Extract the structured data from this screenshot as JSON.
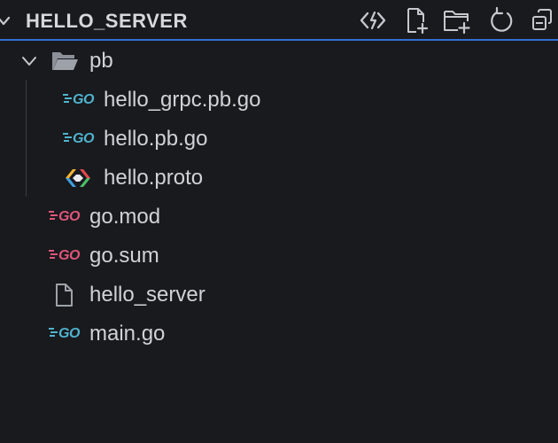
{
  "explorer": {
    "title": "HELLO_SERVER",
    "toolbar": {
      "actions": [
        {
          "name": "go-to-definition",
          "icon": "code-link-icon"
        },
        {
          "name": "new-file",
          "icon": "new-file-icon"
        },
        {
          "name": "new-folder",
          "icon": "new-folder-icon"
        },
        {
          "name": "refresh",
          "icon": "refresh-icon"
        },
        {
          "name": "collapse-all",
          "icon": "collapse-all-icon"
        }
      ]
    },
    "tree": {
      "folder": {
        "label": "pb",
        "expanded": true,
        "icon": "folder-open-icon"
      },
      "pb_children": [
        {
          "label": "hello_grpc.pb.go",
          "icon": "go-file-icon",
          "icon_text": "GO"
        },
        {
          "label": "hello.pb.go",
          "icon": "go-file-icon",
          "icon_text": "GO"
        },
        {
          "label": "hello.proto",
          "icon": "proto-file-icon"
        }
      ],
      "root_files": [
        {
          "label": "go.mod",
          "icon": "go-mod-icon",
          "icon_text": "GO"
        },
        {
          "label": "go.sum",
          "icon": "go-sum-icon",
          "icon_text": "GO"
        },
        {
          "label": "hello_server",
          "icon": "file-icon"
        },
        {
          "label": "main.go",
          "icon": "go-file-icon",
          "icon_text": "GO"
        }
      ]
    },
    "colors": {
      "background": "#191a1d",
      "accent_border": "#2f6fd6",
      "go_blue": "#4fb3cf",
      "go_pink": "#e0567b",
      "text": "#cfd2d8"
    }
  }
}
